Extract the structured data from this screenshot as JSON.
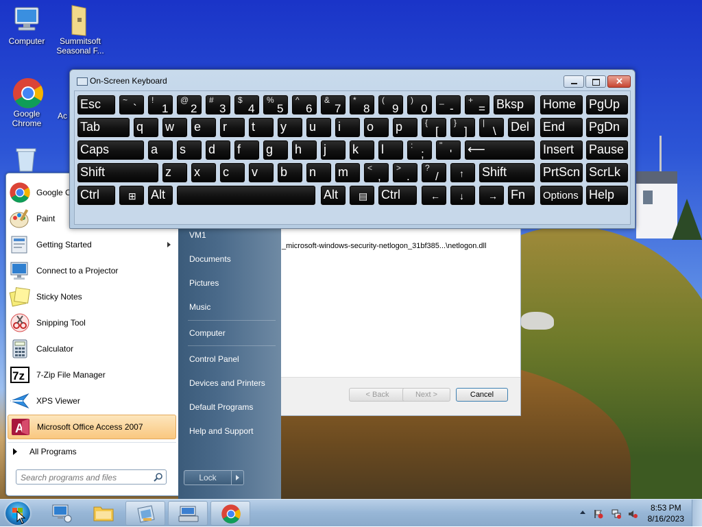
{
  "desktop": {
    "icons": [
      {
        "label": "Computer"
      },
      {
        "label": "Summitsoft Seasonal F..."
      },
      {
        "label": "Google Chrome"
      },
      {
        "label": "Ac"
      }
    ]
  },
  "wizard": {
    "path_text": "_microsoft-windows-security-netlogon_31bf385...\\netlogon.dll",
    "back_label": "< Back",
    "next_label": "Next >",
    "cancel_label": "Cancel"
  },
  "start_menu": {
    "programs": [
      {
        "label": "Google C",
        "icon": "chrome-icon"
      },
      {
        "label": "Paint",
        "icon": "paint-icon"
      },
      {
        "label": "Getting Started",
        "icon": "getting-started-icon",
        "submenu": true
      },
      {
        "label": "Connect to a Projector",
        "icon": "projector-icon"
      },
      {
        "label": "Sticky Notes",
        "icon": "sticky-notes-icon"
      },
      {
        "label": "Snipping Tool",
        "icon": "snipping-tool-icon"
      },
      {
        "label": "Calculator",
        "icon": "calculator-icon"
      },
      {
        "label": "7-Zip File Manager",
        "icon": "7zip-icon"
      },
      {
        "label": "XPS Viewer",
        "icon": "xps-viewer-icon"
      },
      {
        "label": "Microsoft Office Access 2007",
        "icon": "access-icon",
        "highlighted": true
      }
    ],
    "all_programs_label": "All Programs",
    "search_placeholder": "Search programs and files",
    "right_items": [
      {
        "label": "VM1"
      },
      {
        "label": "Documents"
      },
      {
        "label": "Pictures"
      },
      {
        "label": "Music"
      },
      {
        "label": "Computer"
      },
      {
        "label": "Control Panel"
      },
      {
        "label": "Devices and Printers"
      },
      {
        "label": "Default Programs"
      },
      {
        "label": "Help and Support"
      }
    ],
    "lock_label": "Lock"
  },
  "osk": {
    "title": "On-Screen Keyboard",
    "rows": [
      [
        {
          "label": "Esc"
        },
        {
          "shift": "~",
          "main": "`"
        },
        {
          "shift": "!",
          "main": "1"
        },
        {
          "shift": "@",
          "main": "2"
        },
        {
          "shift": "#",
          "main": "3"
        },
        {
          "shift": "$",
          "main": "4"
        },
        {
          "shift": "%",
          "main": "5"
        },
        {
          "shift": "^",
          "main": "6"
        },
        {
          "shift": "&",
          "main": "7"
        },
        {
          "shift": "*",
          "main": "8"
        },
        {
          "shift": "(",
          "main": "9"
        },
        {
          "shift": ")",
          "main": "0"
        },
        {
          "shift": "_",
          "main": "-"
        },
        {
          "shift": "+",
          "main": "="
        },
        {
          "label": "Bksp"
        },
        {
          "label": "Home"
        },
        {
          "label": "PgUp"
        }
      ],
      [
        {
          "label": "Tab"
        },
        {
          "label": "q"
        },
        {
          "label": "w"
        },
        {
          "label": "e"
        },
        {
          "label": "r"
        },
        {
          "label": "t"
        },
        {
          "label": "y"
        },
        {
          "label": "u"
        },
        {
          "label": "i"
        },
        {
          "label": "o"
        },
        {
          "label": "p"
        },
        {
          "shift": "{",
          "main": "["
        },
        {
          "shift": "}",
          "main": "]"
        },
        {
          "shift": "|",
          "main": "\\"
        },
        {
          "label": "Del"
        },
        {
          "label": "End"
        },
        {
          "label": "PgDn"
        }
      ],
      [
        {
          "label": "Caps"
        },
        {
          "label": "a"
        },
        {
          "label": "s"
        },
        {
          "label": "d"
        },
        {
          "label": "f"
        },
        {
          "label": "g"
        },
        {
          "label": "h"
        },
        {
          "label": "j"
        },
        {
          "label": "k"
        },
        {
          "label": "l"
        },
        {
          "shift": ":",
          "main": ";"
        },
        {
          "shift": "\"",
          "main": "'"
        },
        {
          "label": "⟵"
        },
        {
          "label": "Insert"
        },
        {
          "label": "Pause"
        }
      ],
      [
        {
          "label": "Shift"
        },
        {
          "label": "z"
        },
        {
          "label": "x"
        },
        {
          "label": "c"
        },
        {
          "label": "v"
        },
        {
          "label": "b"
        },
        {
          "label": "n"
        },
        {
          "label": "m"
        },
        {
          "shift": "<",
          "main": ","
        },
        {
          "shift": ">",
          "main": "."
        },
        {
          "shift": "?",
          "main": "/"
        },
        {
          "label": "↑"
        },
        {
          "label": "Shift"
        },
        {
          "label": "PrtScn"
        },
        {
          "label": "ScrLk"
        }
      ],
      [
        {
          "label": "Ctrl"
        },
        {
          "label": "⊞"
        },
        {
          "label": "Alt"
        },
        {
          "label": ""
        },
        {
          "label": "Alt"
        },
        {
          "label": "▤"
        },
        {
          "label": "Ctrl"
        },
        {
          "label": "←"
        },
        {
          "label": "↓"
        },
        {
          "label": "→"
        },
        {
          "label": "Fn"
        },
        {
          "label": "Options"
        },
        {
          "label": "Help"
        }
      ]
    ]
  },
  "taskbar": {
    "time": "8:53 PM",
    "date": "8/16/2023"
  }
}
